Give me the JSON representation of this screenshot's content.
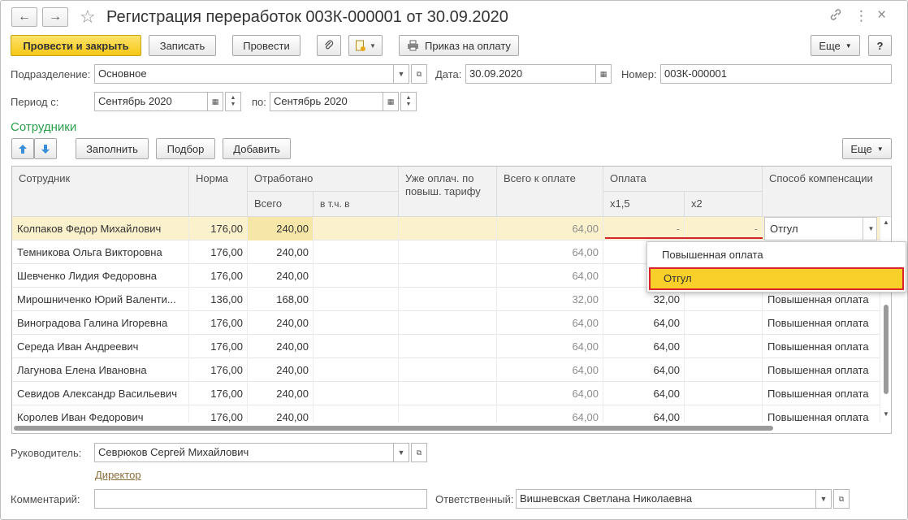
{
  "window": {
    "title": "Регистрация переработок 003К-000001 от 30.09.2020",
    "back_icon": "←",
    "forward_icon": "→",
    "star_icon": "☆",
    "link_icon": "🔗",
    "more_icon": "⋮",
    "close_icon": "×"
  },
  "toolbar": {
    "post_close": "Провести и закрыть",
    "save": "Записать",
    "post": "Провести",
    "attach_icon": "📎",
    "print_order": "Приказ на оплату",
    "more": "Еще",
    "help": "?"
  },
  "header": {
    "division_label": "Подразделение:",
    "division_value": "Основное",
    "date_label": "Дата:",
    "date_value": "30.09.2020",
    "number_label": "Номер:",
    "number_value": "003К-000001",
    "period_from_label": "Период с:",
    "period_from_value": "Сентябрь 2020",
    "period_to_label": "по:",
    "period_to_value": "Сентябрь 2020"
  },
  "employees_section": {
    "title": "Сотрудники",
    "fill": "Заполнить",
    "select": "Подбор",
    "add": "Добавить",
    "more": "Еще"
  },
  "table": {
    "headers": {
      "employee": "Сотрудник",
      "norm": "Норма",
      "worked": "Отработано",
      "worked_total": "Всего",
      "worked_incl": "в т.ч. в",
      "already_paid": "Уже оплач. по повыш. тарифу",
      "total_to_pay": "Всего к оплате",
      "payment": "Оплата",
      "x15": "х1,5",
      "x2": "х2",
      "compensation": "Способ компенсации"
    },
    "rows": [
      {
        "name": "Колпаков Федор Михайлович",
        "norm": "176,00",
        "worked": "240,00",
        "total": "64,00",
        "x15": "-",
        "x2": "-",
        "method": "Отгул"
      },
      {
        "name": "Темникова Ольга Викторовна",
        "norm": "176,00",
        "worked": "240,00",
        "total": "64,00",
        "x15": "",
        "x2": "",
        "method": ""
      },
      {
        "name": "Шевченко Лидия Федоровна",
        "norm": "176,00",
        "worked": "240,00",
        "total": "64,00",
        "x15": "",
        "x2": "",
        "method": ""
      },
      {
        "name": "Мирошниченко Юрий Валенти...",
        "norm": "136,00",
        "worked": "168,00",
        "total": "32,00",
        "x15": "32,00",
        "x2": "",
        "method": "Повышенная оплата"
      },
      {
        "name": "Виноградова Галина Игоревна",
        "norm": "176,00",
        "worked": "240,00",
        "total": "64,00",
        "x15": "64,00",
        "x2": "",
        "method": "Повышенная оплата"
      },
      {
        "name": "Середа Иван Андреевич",
        "norm": "176,00",
        "worked": "240,00",
        "total": "64,00",
        "x15": "64,00",
        "x2": "",
        "method": "Повышенная оплата"
      },
      {
        "name": "Лагунова Елена Ивановна",
        "norm": "176,00",
        "worked": "240,00",
        "total": "64,00",
        "x15": "64,00",
        "x2": "",
        "method": "Повышенная оплата"
      },
      {
        "name": "Севидов Александр Васильевич",
        "norm": "176,00",
        "worked": "240,00",
        "total": "64,00",
        "x15": "64,00",
        "x2": "",
        "method": "Повышенная оплата"
      },
      {
        "name": "Королев Иван Федорович",
        "norm": "176,00",
        "worked": "240,00",
        "total": "64,00",
        "x15": "64,00",
        "x2": "",
        "method": "Повышенная оплата"
      }
    ]
  },
  "dropdown": {
    "options": [
      "Повышенная оплата",
      "Отгул"
    ],
    "selected": "Отгул"
  },
  "footer": {
    "manager_label": "Руководитель:",
    "manager_value": "Севрюков Сергей Михайлович",
    "manager_position": "Директор",
    "comment_label": "Комментарий:",
    "comment_value": "",
    "responsible_label": "Ответственный:",
    "responsible_value": "Вишневская Светлана Николаевна"
  },
  "colors": {
    "accent_yellow": "#f5c816",
    "section_green": "#2aa04c",
    "selected_row": "#fbf1cc",
    "highlight_red": "#d9242a"
  }
}
